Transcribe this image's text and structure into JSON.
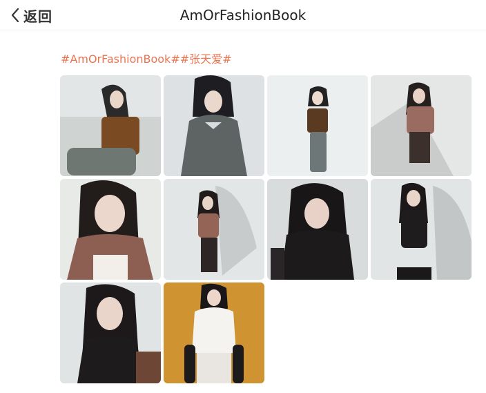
{
  "header": {
    "back_label": "返回",
    "title": "AmOrFashionBook"
  },
  "post": {
    "hashtags": "#AmOrFashionBook##张天爱#"
  },
  "colors": {
    "accent": "#eb7350",
    "divider": "#eeeeee"
  },
  "icons": {
    "back": "chevron-left-icon"
  }
}
